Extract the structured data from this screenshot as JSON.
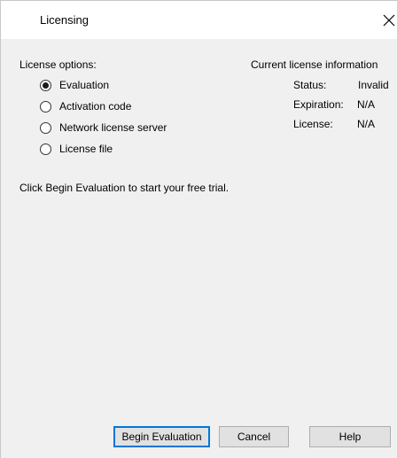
{
  "window": {
    "title": "Licensing",
    "close_icon": "close-icon"
  },
  "options": {
    "label": "License options:",
    "items": [
      {
        "label": "Evaluation",
        "selected": true
      },
      {
        "label": "Activation code",
        "selected": false
      },
      {
        "label": "Network license server",
        "selected": false
      },
      {
        "label": "License file",
        "selected": false
      }
    ]
  },
  "license_info": {
    "header": "Current license information",
    "status_key": "Status:",
    "status_value": "Invalid",
    "expiration_key": "Expiration:",
    "expiration_value": "N/A",
    "license_key": "License:",
    "license_value": "N/A"
  },
  "message": "Click Begin Evaluation to start your free trial.",
  "buttons": {
    "begin": "Begin Evaluation",
    "cancel": "Cancel",
    "help": "Help"
  }
}
